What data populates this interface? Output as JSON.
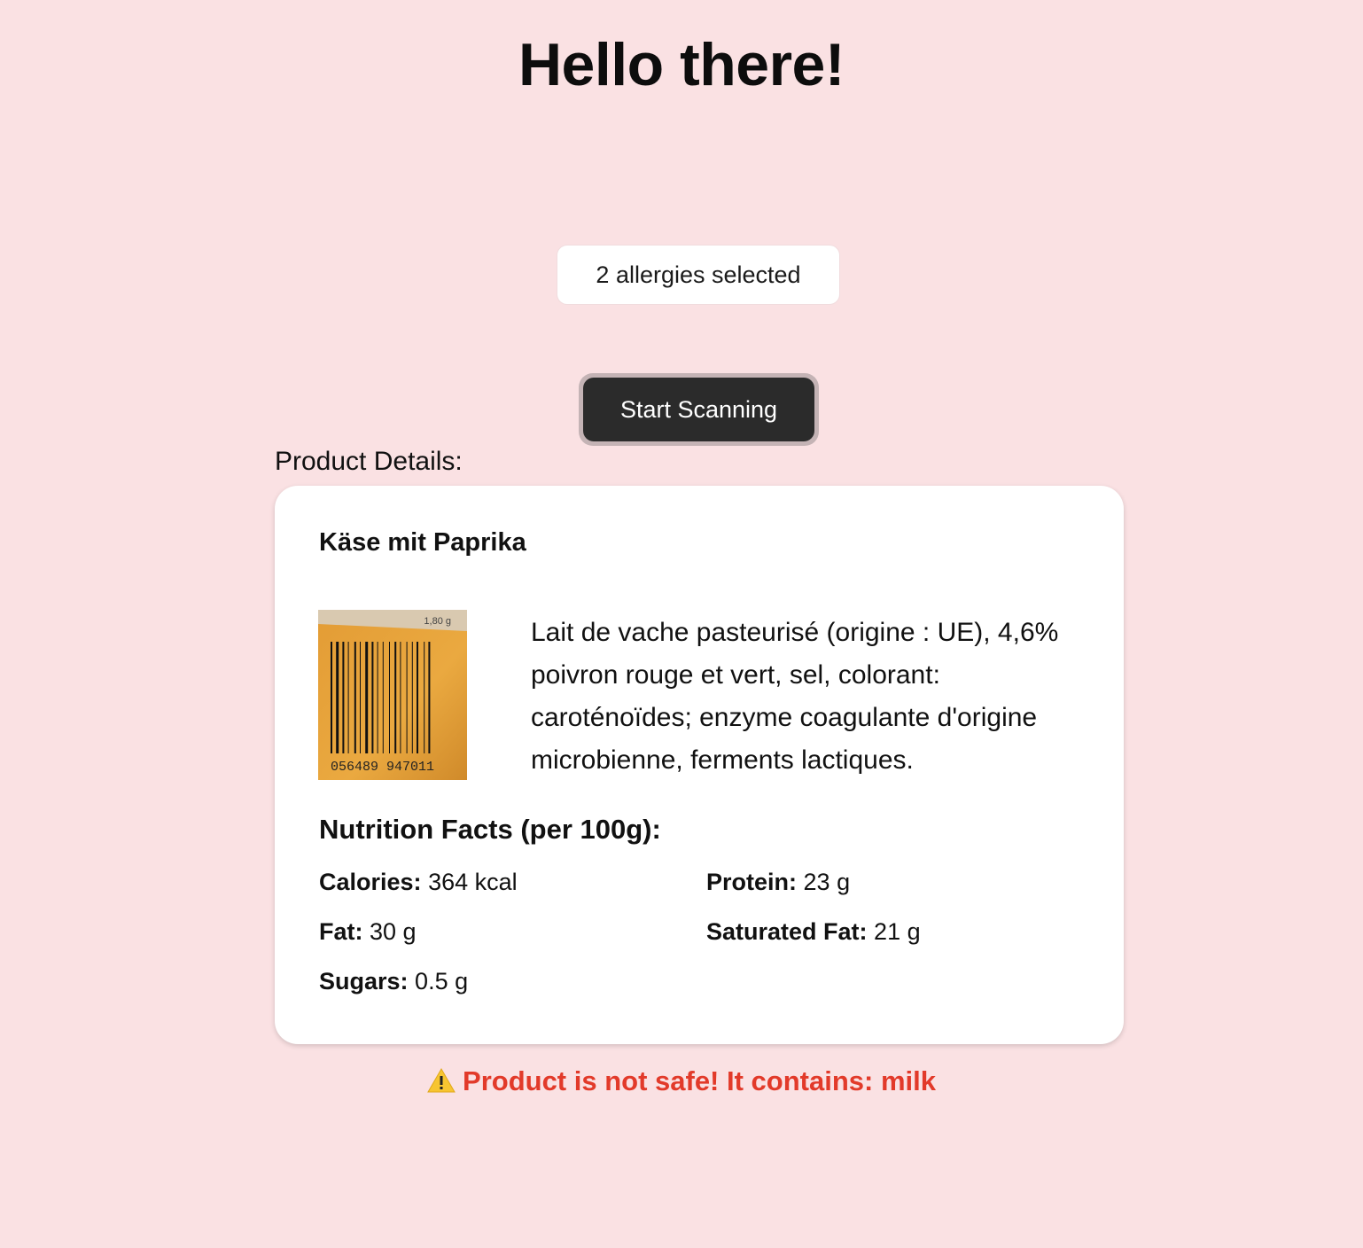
{
  "header": {
    "title": "Hello there!"
  },
  "allergies": {
    "summary": "2 allergies selected"
  },
  "scan": {
    "button_label": "Start Scanning"
  },
  "product_section": {
    "label": "Product Details:"
  },
  "product": {
    "name": "Käse mit Paprika",
    "image_price_label": "1,80 g",
    "image_barcode_digits": "056489 947011",
    "ingredients": "Lait de vache pasteurisé (origine : UE), 4,6% poivron rouge et vert, sel, colorant: caroténoïdes; enzyme coagulante d'origine microbienne, ferments lactiques.",
    "nutrition_title": "Nutrition Facts (per 100g):",
    "nutrition": [
      {
        "label": "Calories:",
        "value": "364 kcal"
      },
      {
        "label": "Protein:",
        "value": "23 g"
      },
      {
        "label": "Fat:",
        "value": "30 g"
      },
      {
        "label": "Saturated Fat:",
        "value": "21 g"
      },
      {
        "label": "Sugars:",
        "value": "0.5 g"
      }
    ]
  },
  "warning": {
    "icon": "warning-icon",
    "text": "Product is not safe! It contains: milk",
    "color": "#e23a2a"
  },
  "colors": {
    "background": "#fae1e3",
    "button": "#2b2b2b",
    "card": "#ffffff"
  }
}
